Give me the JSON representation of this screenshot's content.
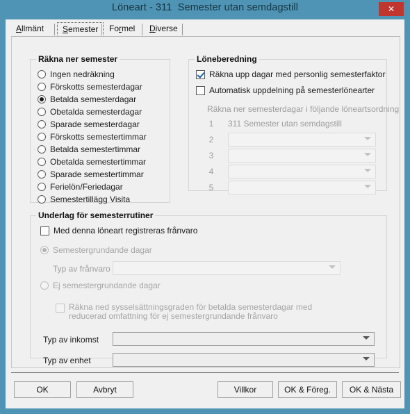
{
  "window": {
    "title": "Löneart - 311  Semester utan semdagstill",
    "close_label": "✕",
    "titlebar_color": "#4f94b5",
    "close_color": "#c1352f"
  },
  "tabs": [
    {
      "label": "Allmänt",
      "acc": "A",
      "selected": false
    },
    {
      "label": "Semester",
      "acc": "S",
      "selected": true
    },
    {
      "label": "Formel",
      "acc": "r",
      "selected": false
    },
    {
      "label": "Diverse",
      "acc": "D",
      "selected": false
    }
  ],
  "rakna_ner_semester": {
    "legend": "Räkna ner semester",
    "options": [
      {
        "label": "Ingen nedräkning",
        "checked": false
      },
      {
        "label": "Förskotts semesterdagar",
        "checked": false
      },
      {
        "label": "Betalda semesterdagar",
        "checked": true
      },
      {
        "label": "Obetalda semesterdagar",
        "checked": false
      },
      {
        "label": "Sparade semesterdagar",
        "checked": false
      },
      {
        "label": "Förskotts semestertimmar",
        "checked": false
      },
      {
        "label": "Betalda semestertimmar",
        "checked": false
      },
      {
        "label": "Obetalda semestertimmar",
        "checked": false
      },
      {
        "label": "Sparade semestertimmar",
        "checked": false
      },
      {
        "label": "Ferielön/Feriedagar",
        "checked": false
      },
      {
        "label": "Semestertillägg Visita",
        "checked": false
      }
    ]
  },
  "loneberedning": {
    "legend": "Löneberedning",
    "checkbox_faktor": {
      "label": "Räkna upp dagar med personlig semesterfaktor",
      "checked": true
    },
    "checkbox_uppdelning": {
      "label": "Automatisk uppdelning på semesterlönearter",
      "checked": false
    },
    "order_caption": "Räkna ner semesterdagar i följande löneartsordning",
    "rows": [
      {
        "num": "1",
        "value": "311 Semester utan semdagstill",
        "type": "text"
      },
      {
        "num": "2",
        "value": "",
        "type": "combo",
        "disabled": true
      },
      {
        "num": "3",
        "value": "",
        "type": "combo",
        "disabled": true
      },
      {
        "num": "4",
        "value": "",
        "type": "combo",
        "disabled": true
      },
      {
        "num": "5",
        "value": "",
        "type": "combo",
        "disabled": true
      }
    ]
  },
  "underlag": {
    "legend": "Underlag för semesterrutiner",
    "checkbox_franvaro": {
      "label": "Med denna löneart registreras frånvaro",
      "checked": false
    },
    "radio_semestergrundande": {
      "label": "Semestergrundande dagar",
      "checked": true,
      "disabled": true
    },
    "radio_ej_semestergrundande": {
      "label": "Ej semestergrundande dagar",
      "checked": false,
      "disabled": true
    },
    "typ_av_franvaro": {
      "label": "Typ av frånvaro",
      "value": "",
      "disabled": true
    },
    "checkbox_reducerad": {
      "label": "Räkna ned sysselsättningsgraden för betalda semesterdagar med reducerad omfattning för ej semestergrundande frånvaro",
      "checked": false,
      "disabled": true
    },
    "typ_av_inkomst": {
      "label": "Typ av inkomst",
      "value": ""
    },
    "typ_av_enhet": {
      "label": "Typ av enhet",
      "value": ""
    }
  },
  "buttons": {
    "ok": "OK",
    "avbryt": "Avbryt",
    "villkor": "Villkor",
    "ok_foreg": "OK & Föreg.",
    "ok_nasta": "OK & Nästa"
  }
}
